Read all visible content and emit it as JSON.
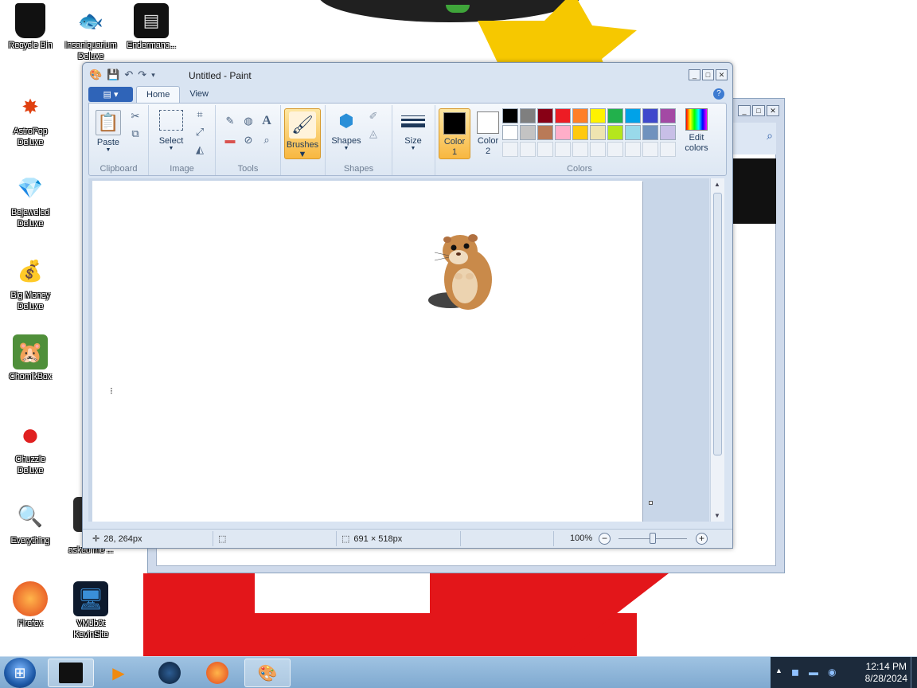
{
  "desktop_icons": [
    {
      "label": "Recycle Bin",
      "icon": "recycle-bin-icon",
      "glyph": "🗑"
    },
    {
      "label": "Insaniquarium\nDeluxe",
      "icon": "fish-icon",
      "glyph": "🐟"
    },
    {
      "label": "Endermanc...",
      "icon": "terminal-icon",
      "glyph": "▤"
    },
    {
      "label": "AstroPop\nDeluxe",
      "icon": "astropop-icon",
      "glyph": "✸"
    },
    {
      "label": "Bejeweled\nDeluxe",
      "icon": "gem-icon",
      "glyph": "💎"
    },
    {
      "label": "Big Money\nDeluxe",
      "icon": "money-bag-icon",
      "glyph": "💰"
    },
    {
      "label": "ChomikBox",
      "icon": "chomikbox-icon",
      "glyph": "🐹"
    },
    {
      "label": "Chuzzle\nDeluxe",
      "icon": "chuzzle-icon",
      "glyph": "●"
    },
    {
      "label": "Everything",
      "icon": "search-icon",
      "glyph": "🔍"
    },
    {
      "label": "Firefox",
      "icon": "firefox-icon",
      "glyph": "🦊"
    },
    {
      "label": "VMJb0t\nKevinSite",
      "icon": "monitor-icon",
      "glyph": "🖥"
    },
    {
      "label": "shit\nasked me ...",
      "icon": "file-icon",
      "glyph": "▮"
    }
  ],
  "paint": {
    "title": "Untitled - Paint",
    "tabs": {
      "home": "Home",
      "view": "View"
    },
    "ribbon": {
      "clipboard": {
        "group": "Clipboard",
        "paste": "Paste"
      },
      "image": {
        "group": "Image",
        "select": "Select"
      },
      "tools": {
        "group": "Tools"
      },
      "brushes": "Brushes",
      "shapes": {
        "group": "Shapes",
        "shapes": "Shapes"
      },
      "size": "Size",
      "colors": {
        "group": "Colors",
        "color1": "Color\n1",
        "color2": "Color\n2",
        "edit_colors": "Edit\ncolors",
        "color1_value": "#000000",
        "color2_value": "#ffffff",
        "palette_row1": [
          "#000000",
          "#7f7f7f",
          "#880015",
          "#ed1c24",
          "#ff7f27",
          "#fff200",
          "#22b14c",
          "#00a2e8",
          "#3f48cc",
          "#a349a4"
        ],
        "palette_row2": [
          "#ffffff",
          "#c3c3c3",
          "#b97a57",
          "#ffaec9",
          "#ffc90e",
          "#efe4b0",
          "#b5e61d",
          "#99d9ea",
          "#7092be",
          "#c8bfe7"
        ]
      }
    },
    "status": {
      "cursor_pos": "28, 264px",
      "image_size": "691 × 518px",
      "zoom": "100%",
      "zoom_fraction": 0.5
    }
  },
  "taskbar": {
    "clock_time": "12:14 PM",
    "clock_date": "8/28/2024"
  }
}
